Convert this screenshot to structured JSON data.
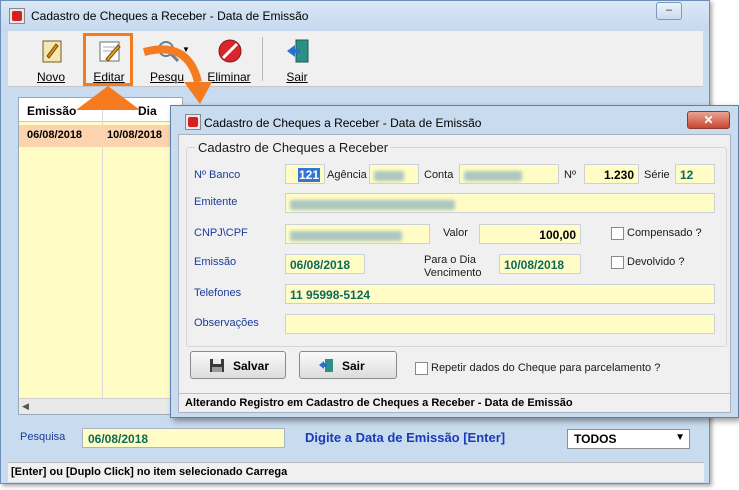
{
  "main_window": {
    "title": "Cadastro de Cheques a Receber - Data de Emissão",
    "minimize": "–",
    "toolbar": {
      "novo": "Novo",
      "editar": "Editar",
      "pesquisar": "Pesqu",
      "eliminar": "Eliminar",
      "sair": "Sair"
    },
    "grid": {
      "columns": [
        "Emissão",
        "Dia"
      ],
      "selected_row": [
        "06/08/2018",
        "10/08/2018"
      ]
    },
    "search": {
      "label": "Pesquisa",
      "value": "06/08/2018",
      "hint": "Digite a Data de Emissão [Enter]",
      "filter": "TODOS"
    },
    "status": "[Enter] ou [Duplo Click] no item selecionado Carrega"
  },
  "dialog": {
    "title": "Cadastro de Cheques a Receber - Data de Emissão",
    "close": "✕",
    "group_title": "Cadastro de Cheques a Receber",
    "labels": {
      "banco": "Nº Banco",
      "agencia": "Agência",
      "conta": "Conta",
      "numero": "Nº",
      "serie": "Série",
      "emitente": "Emitente",
      "cnpj": "CNPJ\\CPF",
      "valor": "Valor",
      "compensado": "Compensado ?",
      "emissao": "Emissão",
      "para_dia_1": "Para o Dia",
      "para_dia_2": "Vencimento",
      "devolvido": "Devolvido ?",
      "telefones": "Telefones",
      "observacoes": "Observações"
    },
    "values": {
      "banco": "121",
      "numero": "1.230",
      "serie": "12",
      "valor": "100,00",
      "emissao": "06/08/2018",
      "vencimento": "10/08/2018",
      "telefones": "11 95998-5124"
    },
    "buttons": {
      "salvar": "Salvar",
      "sair": "Sair"
    },
    "repetir": "Repetir dados do Cheque para parcelamento ?",
    "status": "Alterando Registro em Cadastro de Cheques a Receber - Data de Emissão"
  },
  "colors": {
    "highlight": "#f47b20",
    "field_bg": "#fffcc5",
    "field_text": "#0b6a5b",
    "label_blue": "#1a3c9a"
  }
}
